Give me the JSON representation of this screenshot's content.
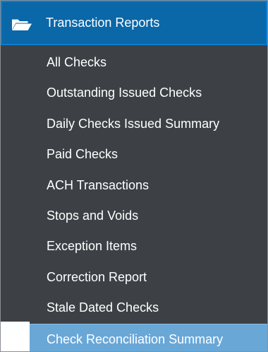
{
  "header": {
    "label": "Transaction Reports",
    "icon": "folder-open-icon"
  },
  "menu": {
    "items": [
      {
        "label": "All Checks",
        "name": "menu-item-all-checks"
      },
      {
        "label": "Outstanding Issued Checks",
        "name": "menu-item-outstanding-issued-checks"
      },
      {
        "label": "Daily Checks Issued Summary",
        "name": "menu-item-daily-checks-issued-summary"
      },
      {
        "label": "Paid Checks",
        "name": "menu-item-paid-checks"
      },
      {
        "label": "ACH Transactions",
        "name": "menu-item-ach-transactions"
      },
      {
        "label": "Stops and Voids",
        "name": "menu-item-stops-and-voids"
      },
      {
        "label": "Exception Items",
        "name": "menu-item-exception-items"
      },
      {
        "label": "Correction Report",
        "name": "menu-item-correction-report"
      },
      {
        "label": "Stale Dated Checks",
        "name": "menu-item-stale-dated-checks"
      },
      {
        "label": "Check Reconciliation Summary",
        "name": "menu-item-check-reconciliation-summary",
        "active": true
      }
    ]
  },
  "colors": {
    "panel_background": "#3d4145",
    "header_background": "#0a67a8",
    "header_border": "#0b7dd0",
    "active_item_background": "#69a7d7",
    "text": "#ffffff"
  }
}
